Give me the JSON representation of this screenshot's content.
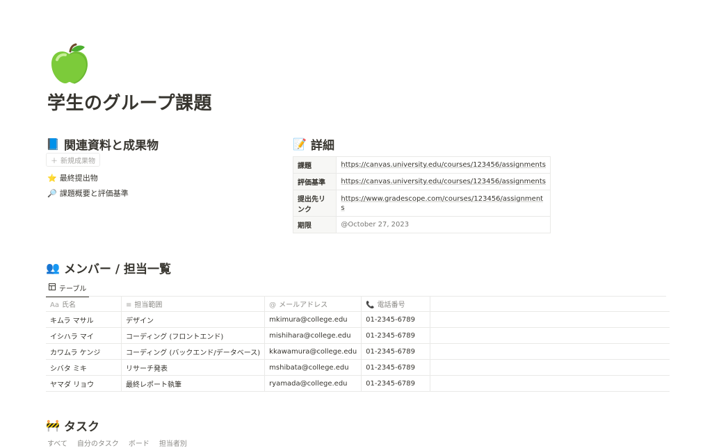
{
  "page": {
    "icon": "green-apple-icon",
    "title": "学生のグループ課題"
  },
  "resources": {
    "heading_emoji": "📘",
    "heading": "関連資料と成果物",
    "new_button": "新規成果物",
    "items": [
      {
        "emoji": "⭐",
        "label": "最終提出物"
      },
      {
        "emoji": "🔎",
        "label": "課題概要と評価基準"
      }
    ]
  },
  "details": {
    "heading_emoji": "📝",
    "heading": "詳細",
    "rows": [
      {
        "key": "課題",
        "value": "https://canvas.university.edu/courses/123456/assignments"
      },
      {
        "key": "評価基準",
        "value": "https://canvas.university.edu/courses/123456/assignments"
      },
      {
        "key": "提出先リンク",
        "value": "https://www.gradescope.com/courses/123456/assignments"
      },
      {
        "key": "期限",
        "value": "@October 27, 2023"
      }
    ]
  },
  "members": {
    "heading_emoji": "👥",
    "heading": "メンバー / 担当一覧",
    "view_tab": "テーブル",
    "columns": [
      "氏名",
      "担当範囲",
      "メールアドレス",
      "電話番号"
    ],
    "column_icons": [
      "Aa",
      "≡",
      "@",
      "📞"
    ],
    "rows": [
      [
        "キムラ マサル",
        "デザイン",
        "mkimura@college.edu",
        "01-2345-6789"
      ],
      [
        "イシハラ マイ",
        "コーディング (フロントエンド)",
        "mishihara@college.edu",
        "01-2345-6789"
      ],
      [
        "カワムラ ケンジ",
        "コーディング (バックエンド/データベース)",
        "kkawamura@college.edu",
        "01-2345-6789"
      ],
      [
        "シバタ ミキ",
        "リサーチ発表",
        "mshibata@college.edu",
        "01-2345-6789"
      ],
      [
        "ヤマダ リョウ",
        "最終レポート執筆",
        "ryamada@college.edu",
        "01-2345-6789"
      ]
    ]
  },
  "tasks": {
    "heading_emoji": "🚧",
    "heading": "タスク",
    "views": [
      "すべて",
      "自分のタスク",
      "ボード",
      "担当者別"
    ]
  }
}
